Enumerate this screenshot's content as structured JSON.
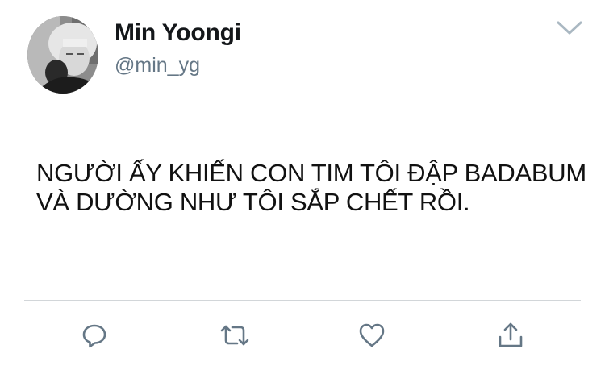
{
  "tweet": {
    "author": {
      "display_name": "Min Yoongi",
      "handle": "@min_yg",
      "avatar": "profile-photo"
    },
    "text_lines": [
      "NGƯỜI ẤY KHIẾN CON TIM TÔI ĐẬP BADABUM",
      "VÀ DƯỜNG NHƯ TÔI SẮP CHẾT RỒI."
    ],
    "menu_icon": "chevron-down-icon",
    "actions": {
      "reply_icon": "reply-icon",
      "retweet_icon": "retweet-icon",
      "like_icon": "heart-icon",
      "share_icon": "share-icon"
    },
    "colors": {
      "name": "#14171a",
      "handle": "#657786",
      "icon": "#657786",
      "divider": "#d2d6d9"
    }
  }
}
